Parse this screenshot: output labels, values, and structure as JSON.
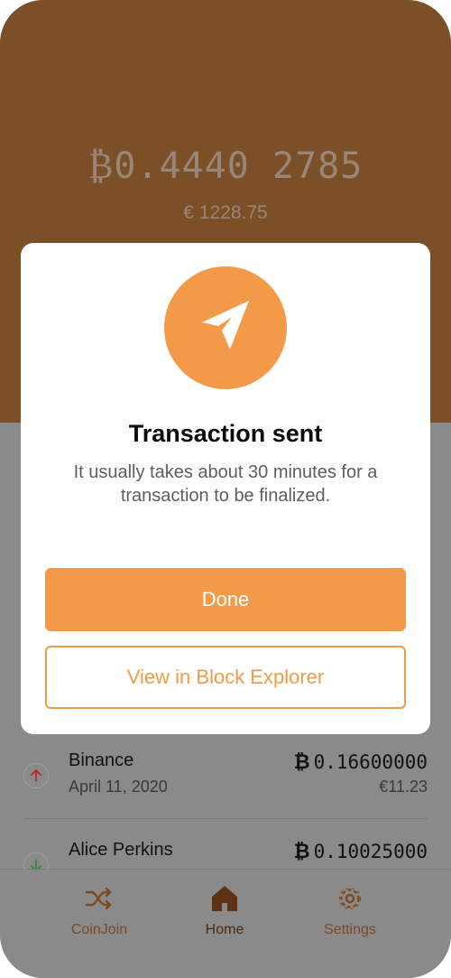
{
  "wallet": {
    "balance_symbol": "₿",
    "balance_value": "0.4440 2785",
    "fiat_balance": "€ 1228.75"
  },
  "transactions": [
    {
      "name": "Binance",
      "date": "April 11, 2020",
      "symbol": "₿",
      "amount": "0.16600000",
      "fiat": "€11.23",
      "direction": "outgoing",
      "icon": "arrow-up-icon"
    },
    {
      "name": "Alice Perkins",
      "symbol": "₿",
      "amount": "0.10025000",
      "direction": "incoming",
      "icon": "arrow-down-icon"
    }
  ],
  "tabbar": {
    "items": [
      {
        "label": "CoinJoin",
        "icon": "shuffle-icon"
      },
      {
        "label": "Home",
        "icon": "home-icon"
      },
      {
        "label": "Settings",
        "icon": "gear-icon"
      }
    ],
    "active": "Home"
  },
  "modal": {
    "icon": "send-icon",
    "title": "Transaction sent",
    "message": "It usually takes about 30 minutes for a transaction to be finalized.",
    "primary_button": "Done",
    "secondary_button": "View in Block Explorer"
  },
  "colors": {
    "accent": "#f29a48",
    "header_brown": "#7b4f28",
    "overlay_gray": "#8a8a8a",
    "outgoing_red": "#b22a2a",
    "incoming_green": "#2f8a3c"
  }
}
